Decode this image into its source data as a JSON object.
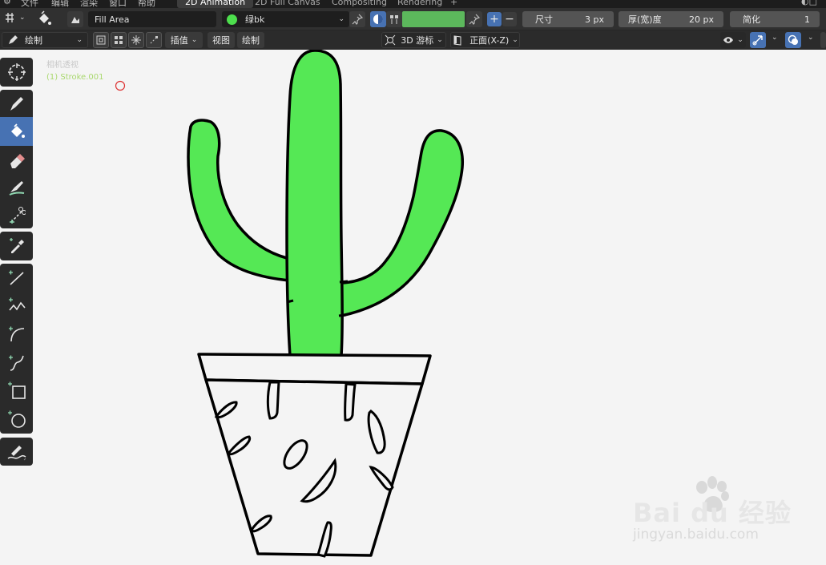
{
  "top_menu": [
    "文件",
    "编辑",
    "渲染",
    "窗口",
    "帮助"
  ],
  "workspace_tabs": [
    {
      "label": "2D Animation",
      "active": true
    },
    {
      "label": "2D Full Canvas",
      "active": false
    },
    {
      "label": "Compositing",
      "active": false
    },
    {
      "label": "Rendering",
      "active": false
    }
  ],
  "add_workspace": "+",
  "header": {
    "brush_name": "Fill Area",
    "material_name": "绿bk",
    "material_color": "#4ddf4d",
    "vertex_color": "#5cb85c",
    "size_label": "尺寸",
    "size_value": "3 px",
    "thickness_label": "厚(宽)度",
    "thickness_value": "20 px",
    "simplify_label": "简化",
    "simplify_value": "1",
    "plus": "+",
    "minus": "−"
  },
  "tool_header": {
    "mode": "绘制",
    "interpolate": "插值",
    "view": "视图",
    "draw": "绘制",
    "cursor_3d": "3D 游标",
    "orientation": "正面(X-Z)"
  },
  "viewport": {
    "camera_label": "相机透视",
    "object_label": "(1) Stroke.001",
    "background": "#f4f4f4",
    "fill_color": "#55e855"
  },
  "watermark": {
    "brand": "Bai du 经验",
    "url": "jingyan.baidu.com"
  },
  "icons": {
    "tools": [
      "cursor-icon",
      "draw-icon",
      "fill-icon",
      "erase-icon",
      "tint-icon",
      "cutter-icon",
      "eyedropper-icon",
      "line-icon",
      "polyline-icon",
      "arc-icon",
      "curve-icon",
      "box-icon",
      "circle-icon",
      "annotate-icon"
    ]
  }
}
